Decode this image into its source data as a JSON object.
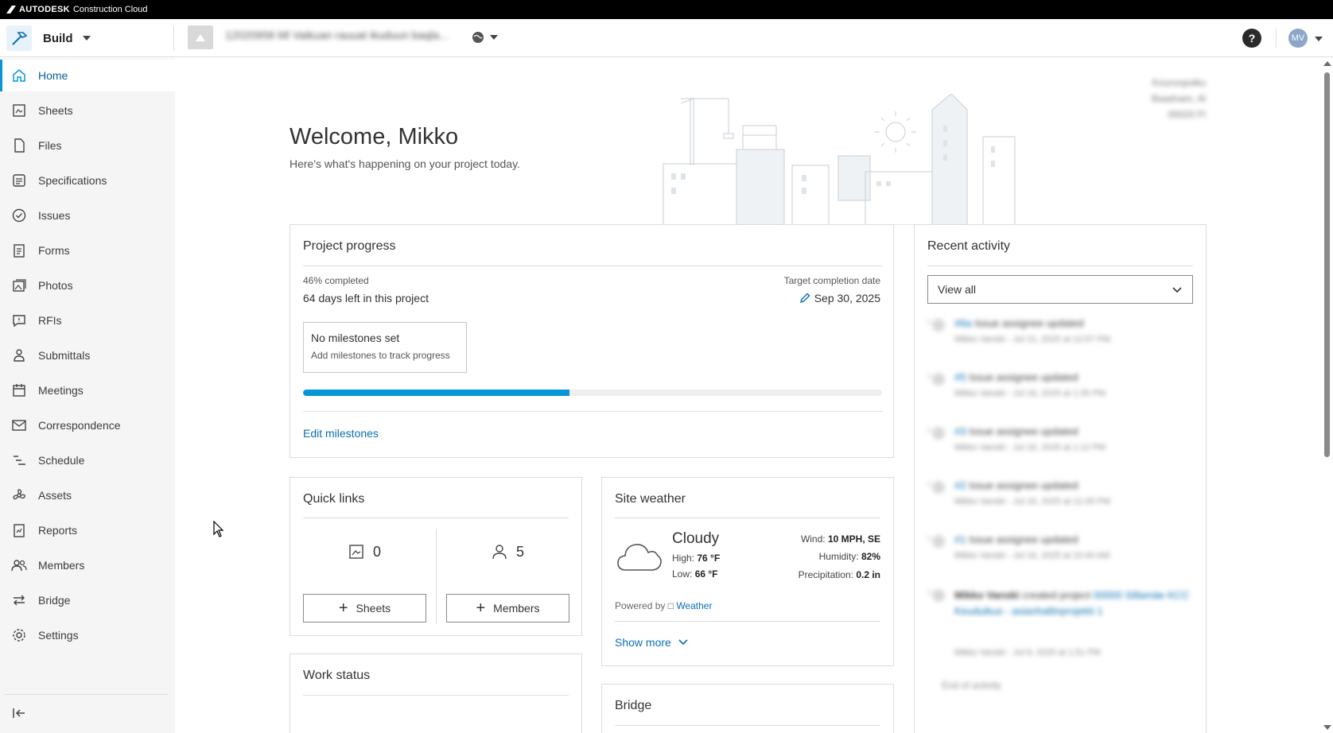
{
  "brand": {
    "company": "AUTODESK",
    "product": "Construction Cloud"
  },
  "header": {
    "product_name": "Build",
    "project_name": "12020958 Ml Vaikuan rauuat ikuduun baqla...",
    "help_label": "?",
    "avatar_initials": "MV"
  },
  "sidebar": {
    "items": [
      {
        "label": "Home",
        "icon": "home-icon"
      },
      {
        "label": "Sheets",
        "icon": "sheets-icon"
      },
      {
        "label": "Files",
        "icon": "file-icon"
      },
      {
        "label": "Specifications",
        "icon": "specifications-icon"
      },
      {
        "label": "Issues",
        "icon": "issues-icon"
      },
      {
        "label": "Forms",
        "icon": "forms-icon"
      },
      {
        "label": "Photos",
        "icon": "photos-icon"
      },
      {
        "label": "RFIs",
        "icon": "rfi-icon"
      },
      {
        "label": "Submittals",
        "icon": "submittals-icon"
      },
      {
        "label": "Meetings",
        "icon": "meetings-icon"
      },
      {
        "label": "Correspondence",
        "icon": "mail-icon"
      },
      {
        "label": "Schedule",
        "icon": "schedule-icon"
      },
      {
        "label": "Assets",
        "icon": "assets-icon"
      },
      {
        "label": "Reports",
        "icon": "reports-icon"
      },
      {
        "label": "Members",
        "icon": "members-icon"
      },
      {
        "label": "Bridge",
        "icon": "bridge-icon"
      },
      {
        "label": "Settings",
        "icon": "gear-icon"
      }
    ],
    "active_index": 0
  },
  "hero": {
    "title": "Welcome, Mikko",
    "subtitle": "Here's what's happening on your project today.",
    "address_lines": [
      "Kourunpolku",
      "Baadnam, Al",
      "00020 FI"
    ]
  },
  "project_progress": {
    "title": "Project progress",
    "percent_label": "46% completed",
    "percent": 46,
    "days_left": "64 days left in this project",
    "target_label": "Target completion date",
    "target_date": "Sep 30, 2025",
    "milestone_title": "No milestones set",
    "milestone_hint": "Add milestones to track progress",
    "edit_link": "Edit milestones"
  },
  "quick_links": {
    "title": "Quick links",
    "sheets_count": "0",
    "members_count": "5",
    "sheets_button": "Sheets",
    "members_button": "Members"
  },
  "work_status": {
    "title": "Work status"
  },
  "site_weather": {
    "title": "Site weather",
    "condition": "Cloudy",
    "high_label": "High:",
    "high_value": "76 °F",
    "low_label": "Low:",
    "low_value": "66 °F",
    "wind_label": "Wind:",
    "wind_value": "10 MPH, SE",
    "humidity_label": "Humidity:",
    "humidity_value": "82%",
    "precip_label": "Precipitation:",
    "precip_value": "0.2 in",
    "powered_by": "Powered by",
    "powered_link": "Weather",
    "show_more": "Show more"
  },
  "bridge_card": {
    "title": "Bridge"
  },
  "recent_activity": {
    "title": "Recent activity",
    "filter_value": "View all",
    "items": [
      {
        "ref": "#6a",
        "text": "Issue assignee updated",
        "meta": "Mikko Vanski - Jul 21, 2025 at 12:57 PM"
      },
      {
        "ref": "#5",
        "text": "Issue assignee updated",
        "meta": "Mikko Vanski - Jul 16, 2025 at 1:35 PM"
      },
      {
        "ref": "#3",
        "text": "Issue assignee updated",
        "meta": "Mikko Vanski - Jul 16, 2025 at 1:12 PM"
      },
      {
        "ref": "#2",
        "text": "Issue assignee updated",
        "meta": "Mikko Vanski - Jul 16, 2025 at 12:45 PM"
      },
      {
        "ref": "#1",
        "text": "Issue assignee updated",
        "meta": "Mikko Vanski - Jul 16, 2025 at 10:40 AM"
      }
    ],
    "created": {
      "who": "Mikko Vanski",
      "text": "created project",
      "link": "00000 Sillamäe KCC Keuduikus - asianhallinprojekti 1",
      "meta": "Mikko Vanski - Jul 8, 2025 at 1:51 PM"
    },
    "end_label": "End of activity"
  }
}
